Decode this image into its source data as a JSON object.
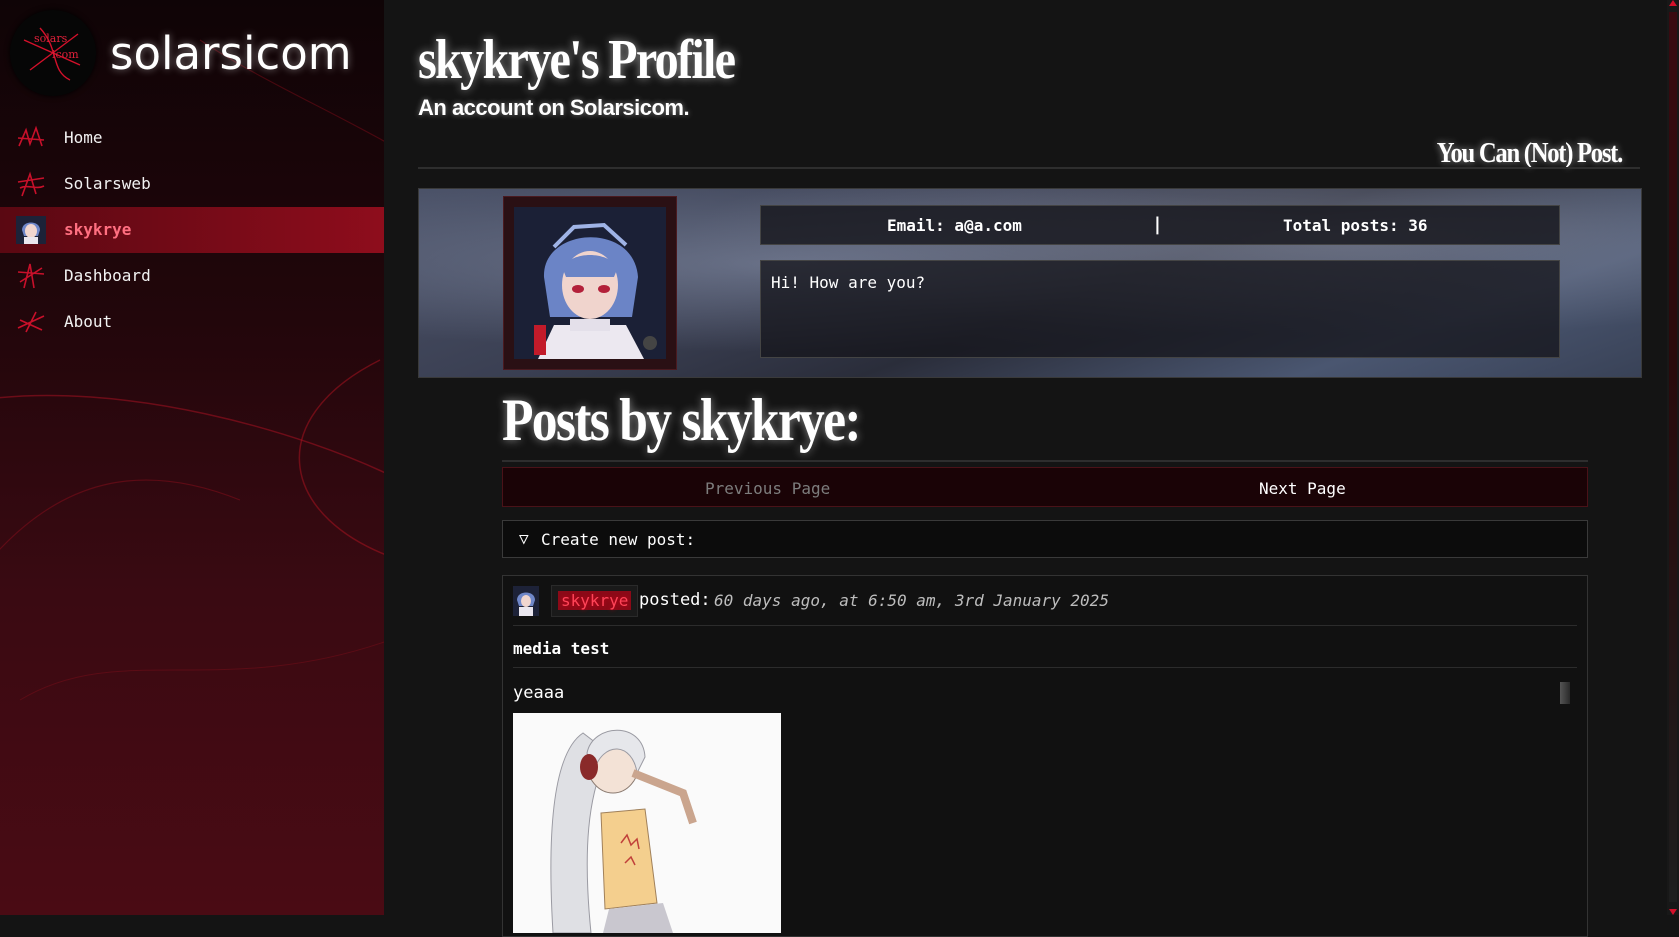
{
  "sidebar": {
    "logo_text_top": "solars",
    "logo_text_bottom": "icom",
    "brand": "solarsicom",
    "items": [
      {
        "label": "Home",
        "icon": "scribble-icon"
      },
      {
        "label": "Solarsweb",
        "icon": "scribble-icon"
      },
      {
        "label": "skykrye",
        "icon": "avatar-icon",
        "active": true
      },
      {
        "label": "Dashboard",
        "icon": "scribble-icon"
      },
      {
        "label": "About",
        "icon": "scribble-icon"
      }
    ]
  },
  "profile": {
    "title": "skykrye's Profile",
    "subtitle": "An account on Solarsicom.",
    "post_permission": "You Can (Not) Post.",
    "email": "Email: a@a.com",
    "separator": "|",
    "total_posts": "Total posts: 36",
    "bio": "Hi! How are you?"
  },
  "posts": {
    "heading": "Posts by skykrye:",
    "prev_label": "Previous Page",
    "next_label": "Next Page",
    "create_toggle": "▽",
    "create_label": "Create new post:"
  },
  "post": {
    "username": "skykrye",
    "posted_label": "posted:",
    "timestamp": "60 days ago, at 6:50 am, 3rd January 2025",
    "title": "media test",
    "body": "yeaaa"
  },
  "colors": {
    "accent": "#e0203a",
    "sidebar_active": "#8e0d1c",
    "background": "#141414"
  }
}
